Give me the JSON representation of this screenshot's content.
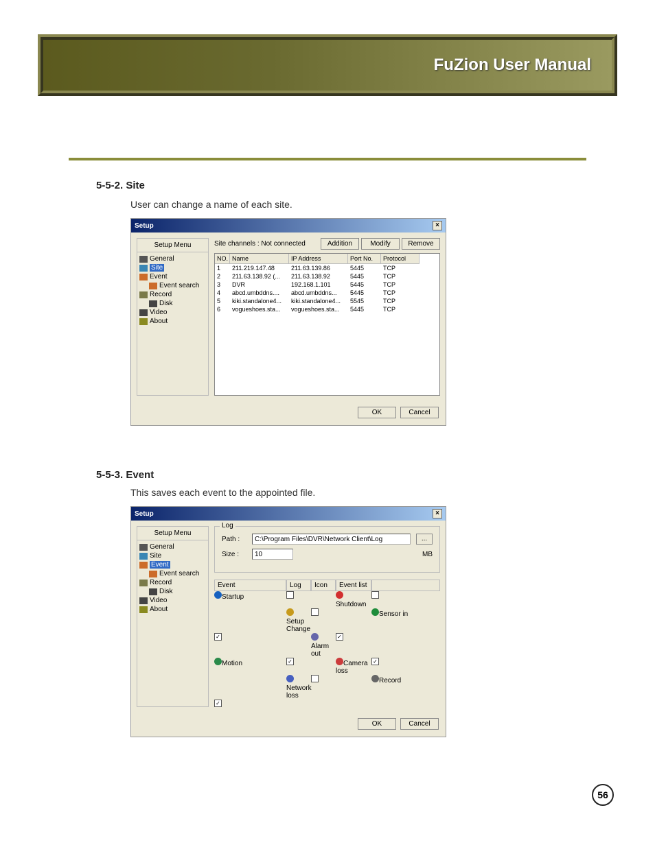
{
  "header": {
    "title": "FuZion User Manual"
  },
  "sections": {
    "site": {
      "heading": "5-5-2. Site",
      "text": "User can change a name of each site."
    },
    "event": {
      "heading": "5-5-3. Event",
      "text": "This saves each event to the appointed file."
    }
  },
  "pageNumber": "56",
  "dialog1": {
    "title": "Setup",
    "menuTitle": "Setup Menu",
    "tree": [
      "General",
      "Site",
      "Event",
      "Event search",
      "Record",
      "Disk",
      "Video",
      "About"
    ],
    "selectedIndex": 1,
    "status": "Site channels : Not connected",
    "buttons": {
      "addition": "Addition",
      "modify": "Modify",
      "remove": "Remove"
    },
    "columns": [
      "NO.",
      "Name",
      "IP Address",
      "Port No.",
      "Protocol"
    ],
    "rows": [
      [
        "1",
        "211.219.147.48",
        "211.63.139.86",
        "5445",
        "TCP"
      ],
      [
        "2",
        "211.63.138.92 (...",
        "211.63.138.92",
        "5445",
        "TCP"
      ],
      [
        "3",
        "DVR",
        "192.168.1.101",
        "5445",
        "TCP"
      ],
      [
        "4",
        "abcd.umbddns....",
        "abcd.umbddns...",
        "5445",
        "TCP"
      ],
      [
        "5",
        "kiki.standalone4...",
        "kiki.standalone4...",
        "5545",
        "TCP"
      ],
      [
        "6",
        "vogueshoes.sta...",
        "vogueshoes.sta...",
        "5445",
        "TCP"
      ]
    ],
    "footer": {
      "ok": "OK",
      "cancel": "Cancel"
    }
  },
  "dialog2": {
    "title": "Setup",
    "menuTitle": "Setup Menu",
    "tree": [
      "General",
      "Site",
      "Event",
      "Event search",
      "Record",
      "Disk",
      "Video",
      "About"
    ],
    "selectedIndex": 2,
    "log": {
      "legend": "Log",
      "pathLabel": "Path :",
      "pathValue": "C:\\Program Files\\DVR\\Network Client\\Log",
      "browse": "...",
      "sizeLabel": "Size :",
      "sizeValue": "10",
      "sizeUnit": "MB"
    },
    "eventColumns": [
      "Event",
      "Log",
      "Icon",
      "Event list"
    ],
    "events": [
      {
        "name": "Startup",
        "log": true,
        "icon": false,
        "list": true,
        "color": "#1560bf"
      },
      {
        "name": "Shutdown",
        "log": true,
        "icon": false,
        "list": true,
        "color": "#d23030"
      },
      {
        "name": "Setup Change",
        "log": true,
        "icon": false,
        "list": true,
        "color": "#c79a1c"
      },
      {
        "name": "Sensor in",
        "log": true,
        "icon": true,
        "list": true,
        "color": "#1e8c3a"
      },
      {
        "name": "Alarm out",
        "log": true,
        "icon": true,
        "list": true,
        "color": "#6666aa"
      },
      {
        "name": "Motion",
        "log": false,
        "icon": true,
        "list": false,
        "color": "#2a8a4a"
      },
      {
        "name": "Camera loss",
        "log": true,
        "icon": true,
        "list": true,
        "color": "#cc3b3b"
      },
      {
        "name": "Network loss",
        "log": true,
        "icon": false,
        "list": true,
        "color": "#4760c0"
      },
      {
        "name": "Record",
        "log": true,
        "icon": true,
        "list": true,
        "color": "#666666"
      }
    ],
    "footer": {
      "ok": "OK",
      "cancel": "Cancel"
    }
  }
}
